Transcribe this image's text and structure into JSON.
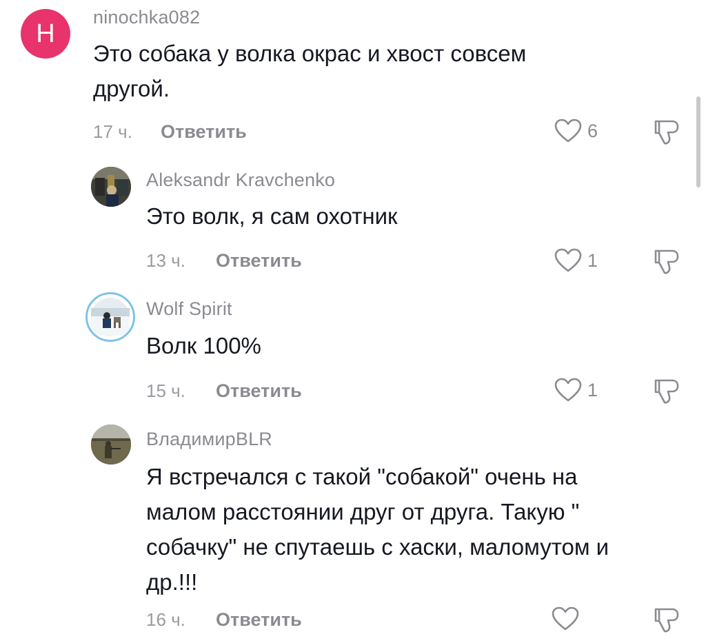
{
  "comments": [
    {
      "avatar_letter": "Н",
      "avatar_color": "#e8336d",
      "username": "ninochka082",
      "text_lines": [
        "Это собака у волка окрас и хвост совсем",
        "другой."
      ],
      "time": "17 ч.",
      "reply": "Ответить",
      "likes": "6"
    },
    {
      "username": "Aleksandr Kravchenko",
      "text_lines": [
        "Это волк, я сам охотник"
      ],
      "time": "13 ч.",
      "reply": "Ответить",
      "likes": "1"
    },
    {
      "username": "Wolf Spirit",
      "text_lines": [
        "Волк 100%"
      ],
      "time": "15 ч.",
      "reply": "Ответить",
      "likes": "1"
    },
    {
      "username": "ВладимирBLR",
      "text_lines": [
        "Я встречался с такой \"собакой\" очень на",
        "малом расстоянии друг от друга. Такую \"",
        "собачку\" не спутаешь с хаски, маломутом и",
        "др.!!!"
      ],
      "time": "16 ч.",
      "reply": "Ответить",
      "likes": ""
    }
  ],
  "icons": {
    "like": "heart-outline-icon",
    "dislike": "thumbs-down-icon"
  }
}
